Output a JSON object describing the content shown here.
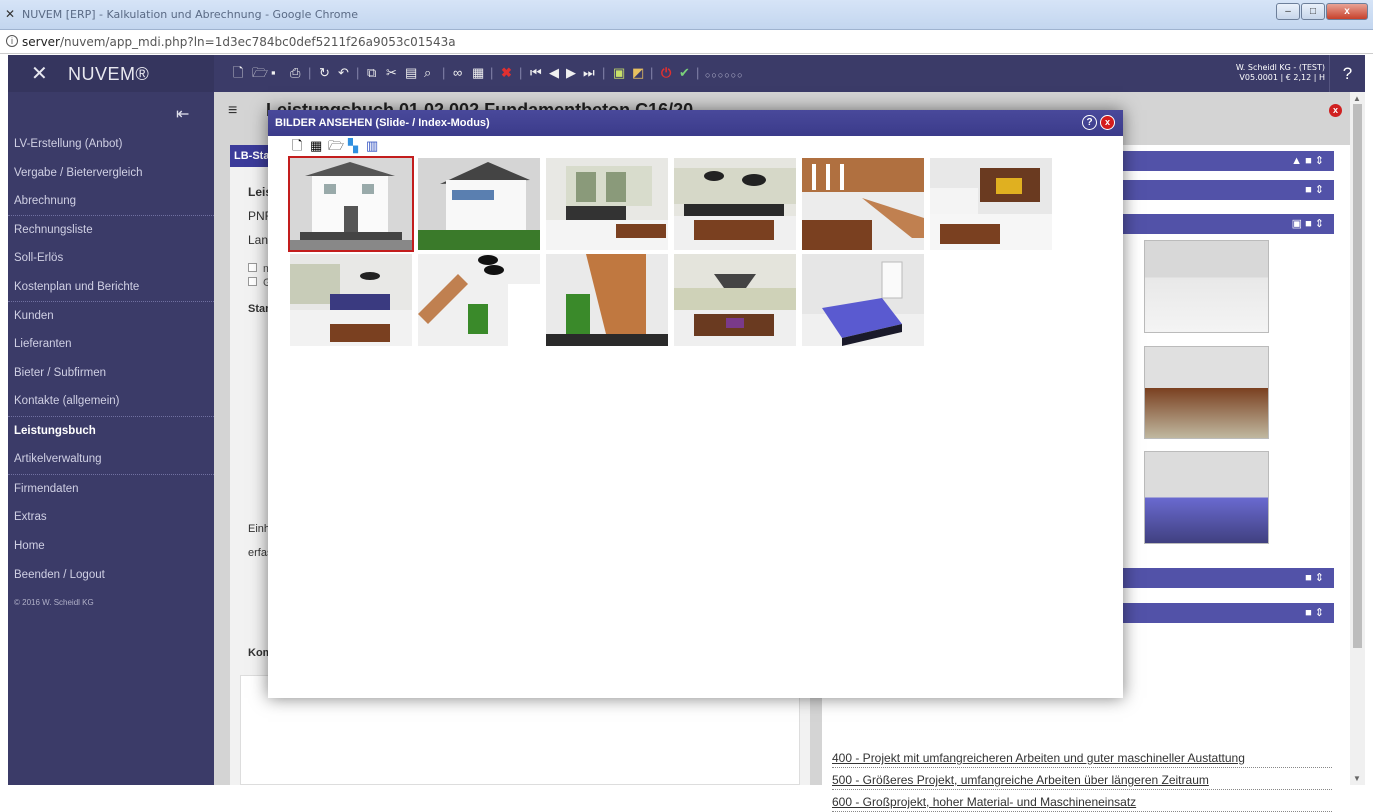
{
  "browser": {
    "title": "NUVEM [ERP] - Kalkulation und Abrechnung - Google Chrome",
    "url_host": "server",
    "url_path": "/nuvem/app_mdi.php?ln=1d3ec784bc0def5211f26a9053c01543a",
    "min": "–",
    "max": "□",
    "close": "x"
  },
  "app": {
    "logo_mark": "✕",
    "logo_text": "NUVEM®",
    "user_line1": "W. Scheidl KG - (TEST)",
    "user_line2": "V05.0001 | € 2,12 | H",
    "help": "?",
    "toolbar_dots": "○○○○○○"
  },
  "sidebar": {
    "collapse_icon": "⇤",
    "items": [
      {
        "label": "LV-Erstellung (Anbot)"
      },
      {
        "label": "Vergabe / Bietervergleich"
      },
      {
        "label": "Abrechnung"
      },
      {
        "label": "Rechnungsliste"
      },
      {
        "label": "Soll-Erlös"
      },
      {
        "label": "Kostenplan und Berichte"
      },
      {
        "label": "Kunden"
      },
      {
        "label": "Lieferanten"
      },
      {
        "label": "Bieter / Subfirmen"
      },
      {
        "label": "Kontakte (allgemein)"
      },
      {
        "label": "Leistungsbuch"
      },
      {
        "label": "Artikelverwaltung"
      },
      {
        "label": "Firmendaten"
      },
      {
        "label": "Extras"
      },
      {
        "label": "Home"
      },
      {
        "label": "Beenden / Logout"
      }
    ],
    "copyright": "© 2016 W. Scheidl KG"
  },
  "page": {
    "menu_icon": "≡",
    "title": "Leistungsbuch 01.02.002 Fundamentbeton C16/20",
    "close": "x"
  },
  "left_panel": {
    "header": "LB-Sta",
    "leist": "Leist",
    "pnr": "PNR:",
    "lang": "Lang",
    "opt1": "mi",
    "opt2": "Gr",
    "stand": "Stan",
    "einhe": "Einhe",
    "erfas": "erfas",
    "komm": "Komm"
  },
  "links": [
    {
      "label": "400 - Projekt mit umfangreicheren Arbeiten und guter maschineller Austattung"
    },
    {
      "label": "500 - Größeres Projekt, umfangreiche Arbeiten über längeren Zeitraum"
    },
    {
      "label": "600 - Großprojekt, hoher Material- und Maschineneinsatz"
    }
  ],
  "modal": {
    "title": "BILDER ANSEHEN (Slide- / Index-Modus)",
    "help": "?",
    "close": "x",
    "tools": [
      "new-icon",
      "settings-icon",
      "open-icon",
      "color-palette-icon",
      "gallery-icon"
    ],
    "images": [
      {
        "name": "house-front",
        "selected": true
      },
      {
        "name": "house-side-balcony",
        "selected": false
      },
      {
        "name": "living-room-dining",
        "selected": false
      },
      {
        "name": "dining-area-kitchen",
        "selected": false
      },
      {
        "name": "staircase-gallery",
        "selected": false
      },
      {
        "name": "kitchen-fireplace",
        "selected": false
      },
      {
        "name": "open-kitchen-living",
        "selected": false
      },
      {
        "name": "stair-pendant-lamps",
        "selected": false
      },
      {
        "name": "wooden-staircase",
        "selected": false
      },
      {
        "name": "dining-table-hood",
        "selected": false
      },
      {
        "name": "bedroom",
        "selected": false
      }
    ]
  }
}
